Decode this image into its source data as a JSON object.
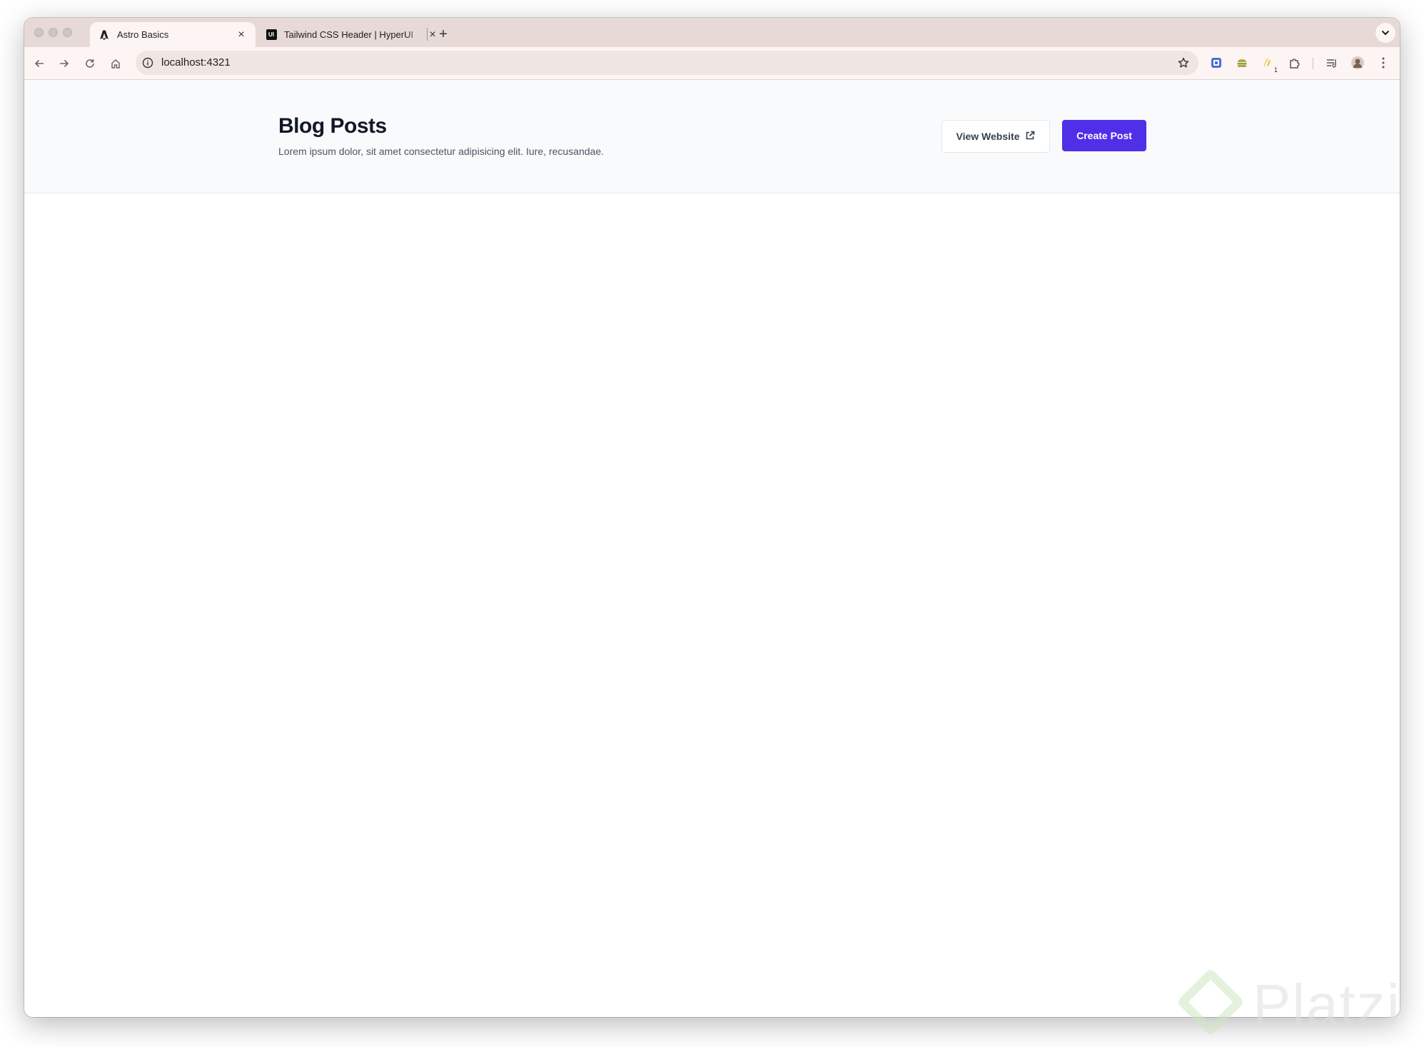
{
  "browser": {
    "tabs": [
      {
        "title": "Astro Basics",
        "favicon": "astro-icon",
        "active": true
      },
      {
        "title": "Tailwind CSS Header | HyperUI",
        "favicon": "hyperui-icon",
        "favicon_text": "UI",
        "active": false
      }
    ],
    "address_bar": {
      "url": "localhost:4321",
      "info_icon": "info-icon"
    },
    "toolbar_icons": [
      "back-icon",
      "forward-icon",
      "reload-icon",
      "home-icon",
      "bookmark-star-icon"
    ],
    "extensions": [
      {
        "name": "ext-blue-icon"
      },
      {
        "name": "ext-sandwich-icon"
      },
      {
        "name": "ext-pencil-icon",
        "badge": "1"
      },
      {
        "name": "puzzle-icon"
      },
      {
        "name": "reading-list-icon"
      },
      {
        "name": "profile-avatar"
      },
      {
        "name": "more-menu-icon"
      }
    ]
  },
  "page": {
    "header": {
      "title": "Blog Posts",
      "subtitle": "Lorem ipsum dolor, sit amet consectetur adipisicing elit. Iure, recusandae."
    },
    "actions": {
      "view_website": "View Website",
      "view_website_icon": "external-link-icon",
      "create_post": "Create Post"
    }
  },
  "watermark": {
    "text": "Platzi"
  },
  "colors": {
    "primary_button": "#4f2fe8",
    "header_background": "#f9fafb",
    "title_text": "#111827",
    "tab_strip": "#e6d9d6"
  }
}
